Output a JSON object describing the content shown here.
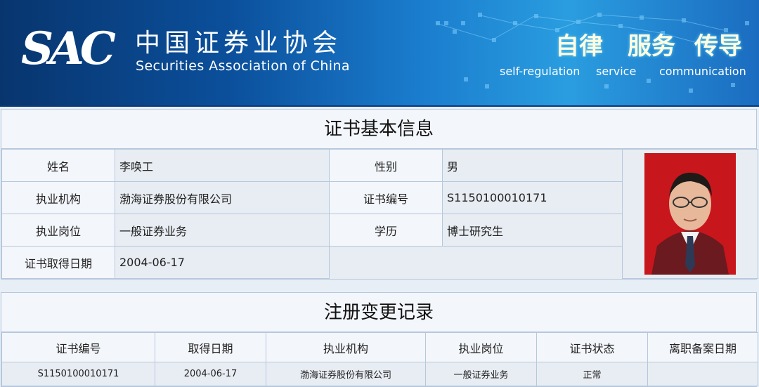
{
  "header": {
    "logo_mark": "SAC",
    "org_name_cn": "中国证券业协会",
    "org_name_en": "Securities Association of China",
    "slogans": [
      {
        "cn": "自律",
        "en": "self-regulation"
      },
      {
        "cn": "服务",
        "en": "service"
      },
      {
        "cn": "传导",
        "en": "communication"
      }
    ]
  },
  "basic_info": {
    "title": "证书基本信息",
    "name_label": "姓名",
    "name_value": "李唤工",
    "gender_label": "性别",
    "gender_value": "男",
    "org_label": "执业机构",
    "org_value": "渤海证券股份有限公司",
    "cert_no_label": "证书编号",
    "cert_no_value": "S1150100010171",
    "position_label": "执业岗位",
    "position_value": "一般证券业务",
    "education_label": "学历",
    "education_value": "博士研究生",
    "date_label": "证书取得日期",
    "date_value": "2004-06-17"
  },
  "change_records": {
    "title": "注册变更记录",
    "columns": [
      "证书编号",
      "取得日期",
      "执业机构",
      "执业岗位",
      "证书状态",
      "离职备案日期"
    ],
    "rows": [
      [
        "S1150100010171",
        "2004-06-17",
        "渤海证券股份有限公司",
        "一般证券业务",
        "正常",
        ""
      ]
    ]
  },
  "colors": {
    "banner_dark": "#08356e",
    "banner_light": "#2a9de0",
    "panel_bg": "#f3f6fa",
    "cell_bg": "#e8edf3",
    "border": "#b6c8dc",
    "photo_bg": "#c8161d"
  }
}
